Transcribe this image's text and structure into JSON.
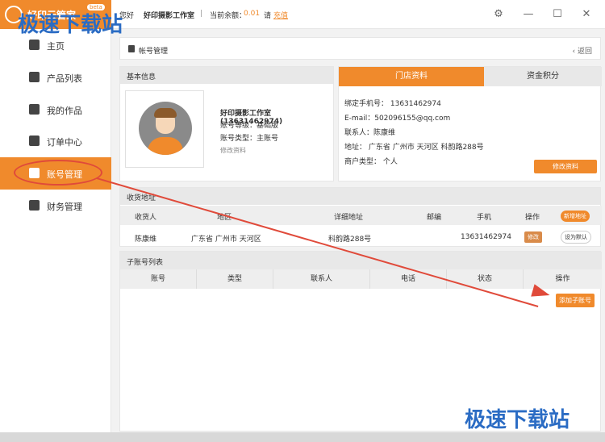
{
  "titlebar": {
    "app_name": "好印云管家",
    "beta": "beta",
    "user_label": "您好",
    "user_name": "好印摄影工作室",
    "separator": "|",
    "balance_label": "当前余额：",
    "balance_value": "0.01",
    "please": "请",
    "recharge": "充值"
  },
  "sidebar": {
    "items": [
      {
        "label": "主页",
        "icon": "home-icon"
      },
      {
        "label": "产品列表",
        "icon": "grid-icon"
      },
      {
        "label": "我的作品",
        "icon": "document-icon"
      },
      {
        "label": "订单中心",
        "icon": "order-icon"
      },
      {
        "label": "账号管理",
        "icon": "user-icon",
        "active": true
      },
      {
        "label": "财务管理",
        "icon": "money-bag-icon"
      }
    ]
  },
  "breadcrumb": {
    "title": "帐号管理",
    "back": "返回"
  },
  "basic_info": {
    "header": "基本信息",
    "name_phone": "好印摄影工作室(13631462974)",
    "level": "账号等级：基础版",
    "type": "账号类型：主账号",
    "edit_link": "修改资料"
  },
  "store": {
    "tab_active": "门店资料",
    "tab_inactive": "资金积分",
    "phone": "绑定手机号： 13631462974",
    "email": "E-mail：502096155@qq.com",
    "contact": "联系人：陈康维",
    "address": "地址： 广东省 广州市 天河区 科韵路288号",
    "merchant_type": "商户类型： 个人",
    "edit_button": "修改资料"
  },
  "shipping": {
    "header": "收货地址",
    "columns": [
      "收货人",
      "地区",
      "详细地址",
      "邮编",
      "手机",
      "操作"
    ],
    "add_button": "新增地址",
    "rows": [
      {
        "name": "陈康维",
        "region": "广东省 广州市 天河区",
        "detail": "科韵路288号",
        "zip": "",
        "phone": "13631462974",
        "edit": "修改",
        "default": "设为默认"
      }
    ]
  },
  "subaccounts": {
    "header": "子账号列表",
    "columns": [
      "账号",
      "类型",
      "联系人",
      "电话",
      "状态",
      "操作"
    ],
    "add_button": "添加子账号"
  },
  "watermark": "极速下载站",
  "colors": {
    "accent": "#f08a2c",
    "annotation": "#e04a3a",
    "watermark": "#2b6cc4"
  }
}
